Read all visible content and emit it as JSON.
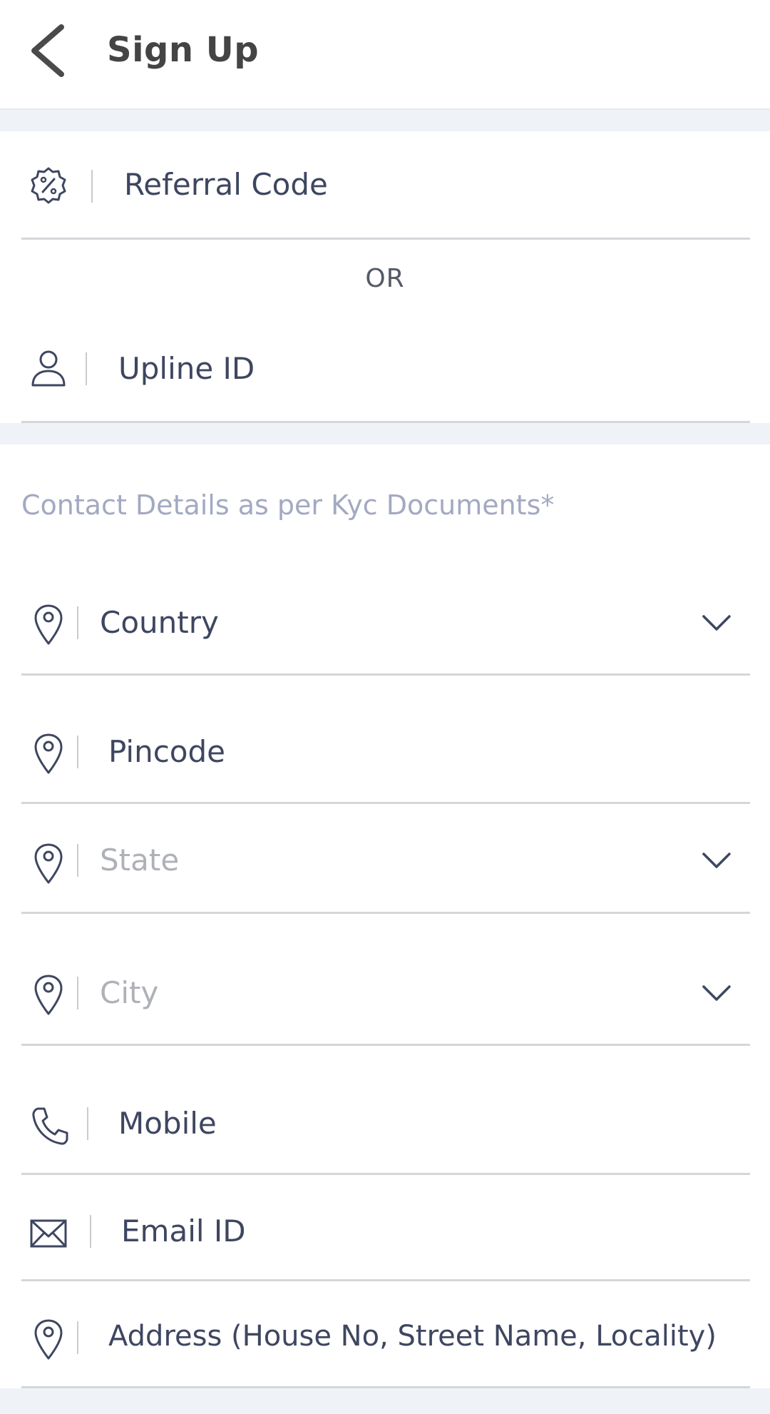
{
  "header": {
    "title": "Sign Up",
    "back_icon": "chevron-left-icon"
  },
  "referral": {
    "placeholder": "Referral Code",
    "icon": "discount-badge-icon"
  },
  "divider_text": "OR",
  "upline": {
    "placeholder": "Upline ID",
    "icon": "user-icon"
  },
  "contact_section": {
    "title": "Contact Details as per Kyc Documents*"
  },
  "fields": {
    "country": {
      "placeholder": "Country",
      "icon": "map-pin-icon",
      "dropdown": true
    },
    "pincode": {
      "placeholder": "Pincode",
      "icon": "map-pin-icon"
    },
    "state": {
      "placeholder": "State",
      "icon": "map-pin-icon",
      "dropdown": true
    },
    "city": {
      "placeholder": "City",
      "icon": "map-pin-icon",
      "dropdown": true
    },
    "mobile": {
      "placeholder": "Mobile",
      "icon": "phone-icon"
    },
    "email": {
      "placeholder": "Email ID",
      "icon": "mail-icon"
    },
    "address": {
      "placeholder": "Address (House No, Street Name, Locality)",
      "icon": "map-pin-icon"
    }
  },
  "colors": {
    "accent_text": "#3e4660",
    "placeholder_muted": "#aeb1b6",
    "section_title": "#a3a9c2",
    "gap_background": "#eff2f6",
    "underline": "#d4d6da"
  }
}
